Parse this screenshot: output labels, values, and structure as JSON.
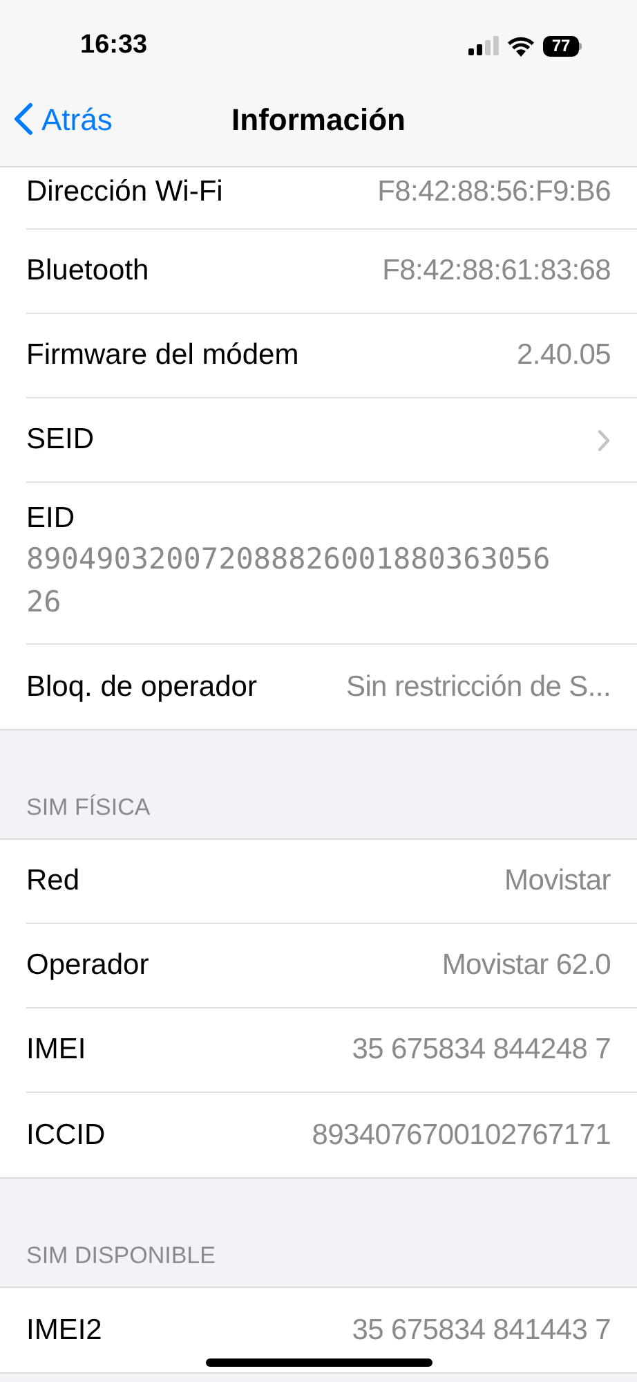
{
  "status_bar": {
    "time": "16:33",
    "battery": "77"
  },
  "nav": {
    "back": "Atrás",
    "title": "Información"
  },
  "groups": [
    {
      "rows": [
        {
          "kind": "value",
          "label": "Dirección Wi-Fi",
          "value": "F8:42:88:56:F9:B6",
          "partial": true
        },
        {
          "kind": "value",
          "label": "Bluetooth",
          "value": "F8:42:88:61:83:68"
        },
        {
          "kind": "value",
          "label": "Firmware del módem",
          "value": "2.40.05"
        },
        {
          "kind": "link",
          "label": "SEID"
        },
        {
          "kind": "stacked",
          "label": "EID",
          "value": "89049032007208882600188036305626"
        },
        {
          "kind": "value",
          "label": "Bloq. de operador",
          "value": "Sin restricción de S..."
        }
      ]
    },
    {
      "header": "SIM FÍSICA",
      "rows": [
        {
          "kind": "value",
          "label": "Red",
          "value": "Movistar"
        },
        {
          "kind": "value",
          "label": "Operador",
          "value": "Movistar 62.0"
        },
        {
          "kind": "value",
          "label": "IMEI",
          "value": "35 675834 844248 7"
        },
        {
          "kind": "value",
          "label": "ICCID",
          "value": "8934076700102767171"
        }
      ]
    },
    {
      "header": "SIM DISPONIBLE",
      "rows": [
        {
          "kind": "value",
          "label": "IMEI2",
          "value": "35 675834 841443 7"
        }
      ]
    }
  ]
}
